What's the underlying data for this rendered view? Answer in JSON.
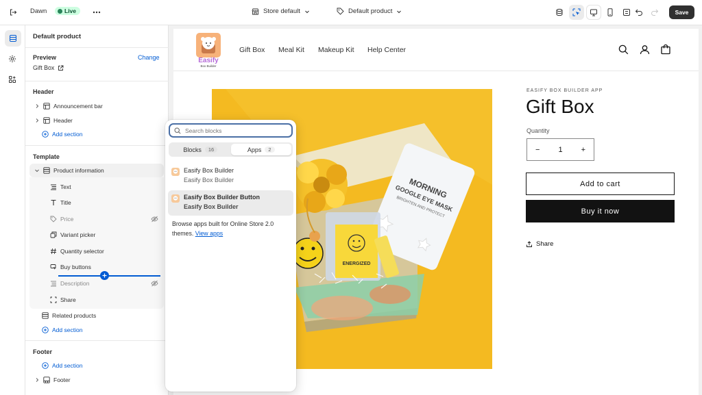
{
  "topbar": {
    "theme_name": "Dawn",
    "status": "Live",
    "store_select": "Store default",
    "template_select": "Default product",
    "save_label": "Save"
  },
  "sidebar": {
    "title": "Default product",
    "preview": {
      "label": "Preview",
      "change": "Change",
      "value": "Gift Box"
    },
    "header": {
      "title": "Header",
      "items": [
        "Announcement bar",
        "Header"
      ],
      "add": "Add section"
    },
    "template": {
      "title": "Template",
      "section": "Product information",
      "blocks": [
        "Text",
        "Title",
        "Price",
        "Variant picker",
        "Quantity selector",
        "Buy buttons",
        "Description",
        "Share"
      ],
      "related": "Related products",
      "add": "Add section"
    },
    "footer": {
      "title": "Footer",
      "add": "Add section",
      "item": "Footer"
    }
  },
  "popover": {
    "search_placeholder": "Search blocks",
    "tabs": [
      {
        "label": "Blocks",
        "count": "16"
      },
      {
        "label": "Apps",
        "count": "2"
      }
    ],
    "apps": [
      {
        "title": "Easify Box Builder",
        "sub": "Easify Box Builder"
      },
      {
        "title": "Easify Box Builder Button",
        "sub": "Easify Box Builder"
      }
    ],
    "browse_text": "Browse apps built for Online Store 2.0 themes.",
    "view_apps": "View apps"
  },
  "store": {
    "logo_text": "Easify",
    "logo_sub": "Box Builder",
    "nav": [
      "Gift Box",
      "Meal Kit",
      "Makeup Kit",
      "Help Center"
    ],
    "vendor": "EASIFY BOX BUILDER APP",
    "product_title": "Gift Box",
    "quantity_label": "Quantity",
    "quantity_value": "1",
    "qty_minus": "−",
    "qty_plus": "+",
    "add_to_cart": "Add to cart",
    "buy_now": "Buy it now",
    "share": "Share",
    "image_text": {
      "morning": "MORNING",
      "mask": "GOOGLE EYE MASK",
      "brighten": "BRIGHTEN AND PROTECT",
      "energized": "ENERGIZED"
    }
  },
  "colors": {
    "accent": "#005bd3",
    "primary": "#303030",
    "live": "#29845a",
    "hero_bg": "#f4ba21"
  }
}
